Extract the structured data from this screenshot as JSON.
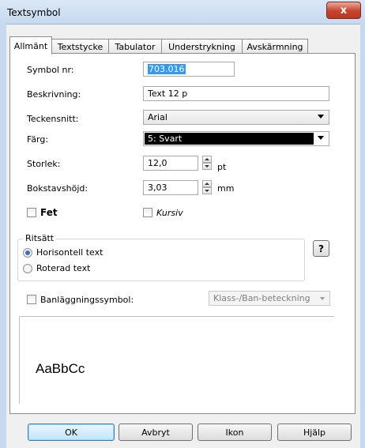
{
  "window": {
    "title": "Textsymbol",
    "close_glyph": "x"
  },
  "tabs": [
    {
      "label": "Allmänt",
      "active": true
    },
    {
      "label": "Textstycke",
      "active": false
    },
    {
      "label": "Tabulator",
      "active": false
    },
    {
      "label": "Understrykning",
      "active": false
    },
    {
      "label": "Avskärmning",
      "active": false
    }
  ],
  "form": {
    "symbol_nr": {
      "label": "Symbol nr:",
      "value": "703.016"
    },
    "beskrivning": {
      "label": "Beskrivning:",
      "value": "Text 12 p"
    },
    "teckensnitt": {
      "label": "Teckensnitt:",
      "value": "Arial"
    },
    "farg": {
      "label": "Färg:",
      "value": "5: Svart",
      "swatch": "#000000"
    },
    "storlek": {
      "label": "Storlek:",
      "value": "12,0",
      "unit": "pt"
    },
    "bokstavshojd": {
      "label": "Bokstavshöjd:",
      "value": "3,03",
      "unit": "mm"
    },
    "fet": {
      "label": "Fet",
      "checked": false
    },
    "kursiv": {
      "label": "Kursiv",
      "checked": false
    },
    "ritsatt": {
      "legend": "Ritsätt",
      "options": [
        {
          "label": "Horisontell text",
          "checked": true
        },
        {
          "label": "Roterad text",
          "checked": false
        }
      ],
      "help_label": "?"
    },
    "banlaggning": {
      "label": "Banläggningssymbol:",
      "checked": false,
      "select_value": "Klass-/Ban-beteckning"
    }
  },
  "preview": {
    "sample_text": "AaBbCc"
  },
  "buttons": {
    "ok": "OK",
    "cancel": "Avbryt",
    "icon": "Ikon",
    "help": "Hjälp"
  },
  "colors": {
    "selection": "#3399ff",
    "title_bar": "#c6d9ef",
    "close": "#c8432c"
  }
}
